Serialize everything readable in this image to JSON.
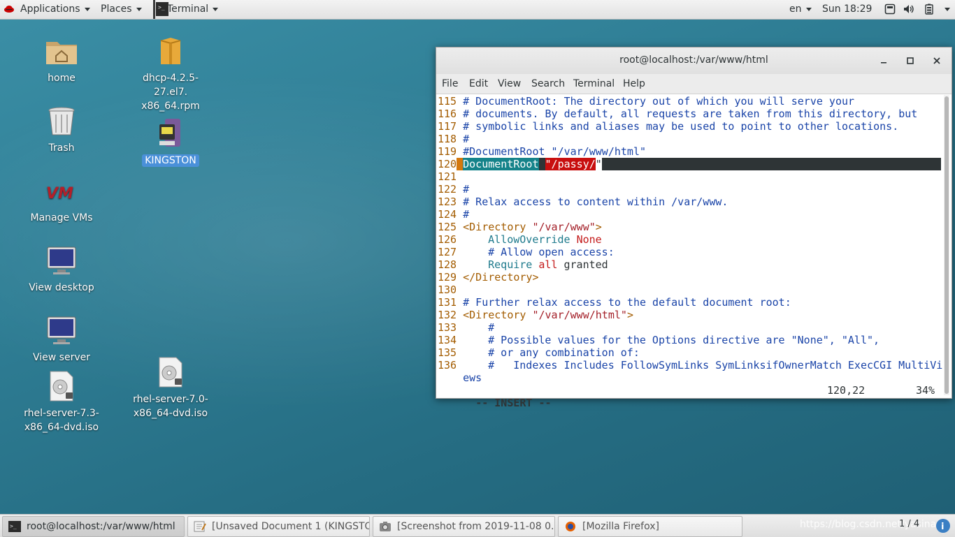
{
  "top_panel": {
    "applications": "Applications",
    "places": "Places",
    "terminal": "Terminal",
    "language": "en",
    "clock": "Sun 18:29",
    "icons": [
      "redhat-icon",
      "terminal-icon",
      "screen-icon",
      "volume-icon",
      "battery-icon"
    ]
  },
  "desktop_icons": [
    {
      "label": "home",
      "icon": "home-folder-icon"
    },
    {
      "label": "dhcp-4.2.5-27.el7.x86_64.rpm",
      "line1": "dhcp-4.2.5-27.el7.",
      "line2": "x86_64.rpm",
      "icon": "package-icon"
    },
    {
      "label": "Trash",
      "icon": "trash-icon"
    },
    {
      "label": "KINGSTON",
      "icon": "usb-drive-icon",
      "selected": true
    },
    {
      "label": "Manage VMs",
      "icon": "vm-icon"
    },
    {
      "label": "View desktop",
      "icon": "monitor-icon"
    },
    {
      "label": "View server",
      "icon": "monitor-icon"
    },
    {
      "label": "rhel-server-7.3-x86_64-dvd.iso",
      "line1": "rhel-server-7.3-",
      "line2": "x86_64-dvd.iso",
      "icon": "disc-image-icon"
    },
    {
      "label": "rhel-server-7.0-x86_64-dvd.iso",
      "line1": "rhel-server-7.0-",
      "line2": "x86_64-dvd.iso",
      "icon": "disc-image-icon"
    }
  ],
  "terminal": {
    "title": "root@localhost:/var/www/html",
    "menu": [
      "File",
      "Edit",
      "View",
      "Search",
      "Terminal",
      "Help"
    ],
    "lines": {
      "l115": {
        "n": "115",
        "t": "# DocumentRoot: The directory out of which you will serve your"
      },
      "l116": {
        "n": "116",
        "t": "# documents. By default, all requests are taken from this directory, but"
      },
      "l117": {
        "n": "117",
        "t": "# symbolic links and aliases may be used to point to other locations."
      },
      "l118": {
        "n": "118",
        "t": "#"
      },
      "l119": {
        "n": "119",
        "t": "#DocumentRoot \"/var/www/html\""
      },
      "l120": {
        "n": "120",
        "kw": "DocumentRoot",
        "val": "\"/passy/",
        "tail": "\""
      },
      "l121": {
        "n": "121"
      },
      "l122": {
        "n": "122",
        "t": "#"
      },
      "l123": {
        "n": "123",
        "t": "# Relax access to content within /var/www."
      },
      "l124": {
        "n": "124",
        "t": "#"
      },
      "l125": {
        "n": "125",
        "tag": "<Directory ",
        "str": "\"/var/www\"",
        "end": ">"
      },
      "l126": {
        "n": "126",
        "kw": "AllowOverride",
        "val": "None"
      },
      "l127": {
        "n": "127",
        "t": "# Allow open access:"
      },
      "l128": {
        "n": "128",
        "kw": "Require",
        "val": "all",
        "rest": "granted"
      },
      "l129": {
        "n": "129",
        "t": "</Directory>"
      },
      "l130": {
        "n": "130"
      },
      "l131": {
        "n": "131",
        "t": "# Further relax access to the default document root:"
      },
      "l132": {
        "n": "132",
        "tag": "<Directory ",
        "str": "\"/var/www/html\"",
        "end": ">"
      },
      "l133": {
        "n": "133",
        "t": "#"
      },
      "l134": {
        "n": "134",
        "t": "# Possible values for the Options directive are \"None\", \"All\","
      },
      "l135": {
        "n": "135",
        "t": "# or any combination of:"
      },
      "l136": {
        "n": "136",
        "t": "#   Indexes Includes FollowSymLinks SymLinksifOwnerMatch ExecCGI MultiVi"
      },
      "l136b": {
        "t": "ews"
      }
    },
    "status": {
      "mode": "-- INSERT --",
      "position": "120,22",
      "percent": "34%"
    }
  },
  "taskbar": {
    "items": [
      {
        "label": "root@localhost:/var/www/html",
        "icon": "terminal-icon",
        "active": true
      },
      {
        "label": "[Unsaved Document 1 (KINGSTO...",
        "icon": "text-editor-icon"
      },
      {
        "label": "[Screenshot from 2019-11-08 0...",
        "icon": "screenshot-icon"
      },
      {
        "label": "[Mozilla Firefox]",
        "icon": "firefox-icon"
      }
    ],
    "workspace": "1 / 4",
    "watermark": "https://blog.csdn.net/yasina..."
  }
}
